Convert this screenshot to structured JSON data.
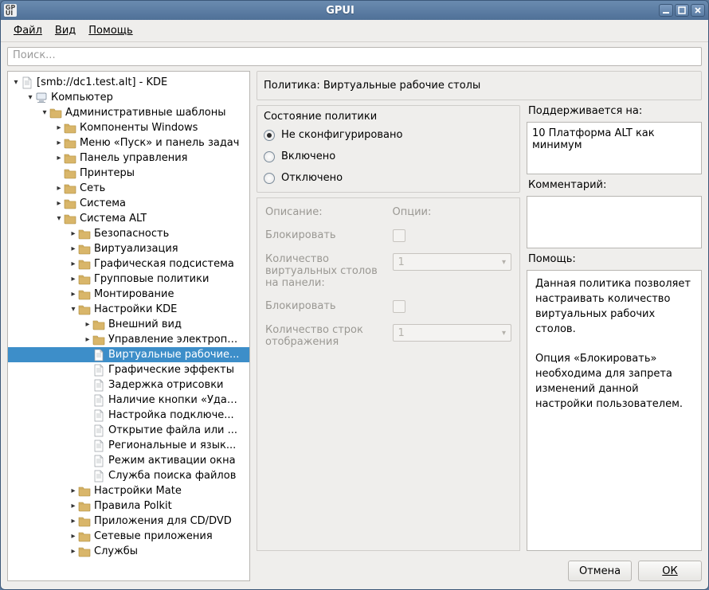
{
  "window": {
    "title": "GPUI",
    "app_icon_text": "GP\nUI"
  },
  "menubar": {
    "file": "Файл",
    "view": "Вид",
    "help": "Помощь"
  },
  "search": {
    "placeholder": "Поиск..."
  },
  "tree": {
    "root": "[smb://dc1.test.alt] - KDE",
    "computer": "Компьютер",
    "admin_templates": "Административные шаблоны",
    "windows_components": "Компоненты Windows",
    "start_menu": "Меню «Пуск» и панель задач",
    "control_panel": "Панель управления",
    "printers": "Принтеры",
    "network": "Сеть",
    "system": "Система",
    "system_alt": "Система ALT",
    "security": "Безопасность",
    "virtualization": "Виртуализация",
    "graphics_subsystem": "Графическая подсистема",
    "group_policies": "Групповые политики",
    "mounting": "Монтирование",
    "kde_settings": "Настройки KDE",
    "appearance": "Внешний вид",
    "email_mgmt": "Управление электроп…",
    "virtual_desktops": "Виртуальные рабочие...",
    "graphic_effects": "Графические эффекты",
    "render_delay": "Задержка отрисовки",
    "delete_button": "Наличие кнопки «Уда…",
    "connection_settings": "Настройка подключе...",
    "open_file": "Открытие файла или ...",
    "regional": "Региональные и язык...",
    "window_activation": "Режим активации окна",
    "file_search": "Служба поиска файлов",
    "mate_settings": "Настройки Mate",
    "polkit_rules": "Правила Polkit",
    "cd_dvd_apps": "Приложения для CD/DVD",
    "network_apps": "Сетевые приложения",
    "services": "Службы"
  },
  "policy": {
    "title_prefix": "Политика: ",
    "title": "Виртуальные рабочие столы",
    "state_heading": "Состояние политики",
    "not_configured": "Не сконфигурировано",
    "enabled": "Включено",
    "disabled": "Отключено"
  },
  "options": {
    "description": "Описание:",
    "options_label": "Опции:",
    "lock": "Блокировать",
    "virtual_count": "Количество виртуальных столов на панели:",
    "rows_count": "Количество строк отображения",
    "select_value": "1"
  },
  "right": {
    "supported_label": "Поддерживается на:",
    "supported_value": "10 Платформа ALT как минимум",
    "comment_label": "Комментарий:",
    "help_label": "Помощь:",
    "help_p1": "Данная политика позволяет настраивать количество виртуальных рабочих столов.",
    "help_p2": "Опция «Блокировать» необходима для запрета изменений данной настройки пользователем."
  },
  "buttons": {
    "cancel": "Отмена",
    "ok": "ОК"
  }
}
